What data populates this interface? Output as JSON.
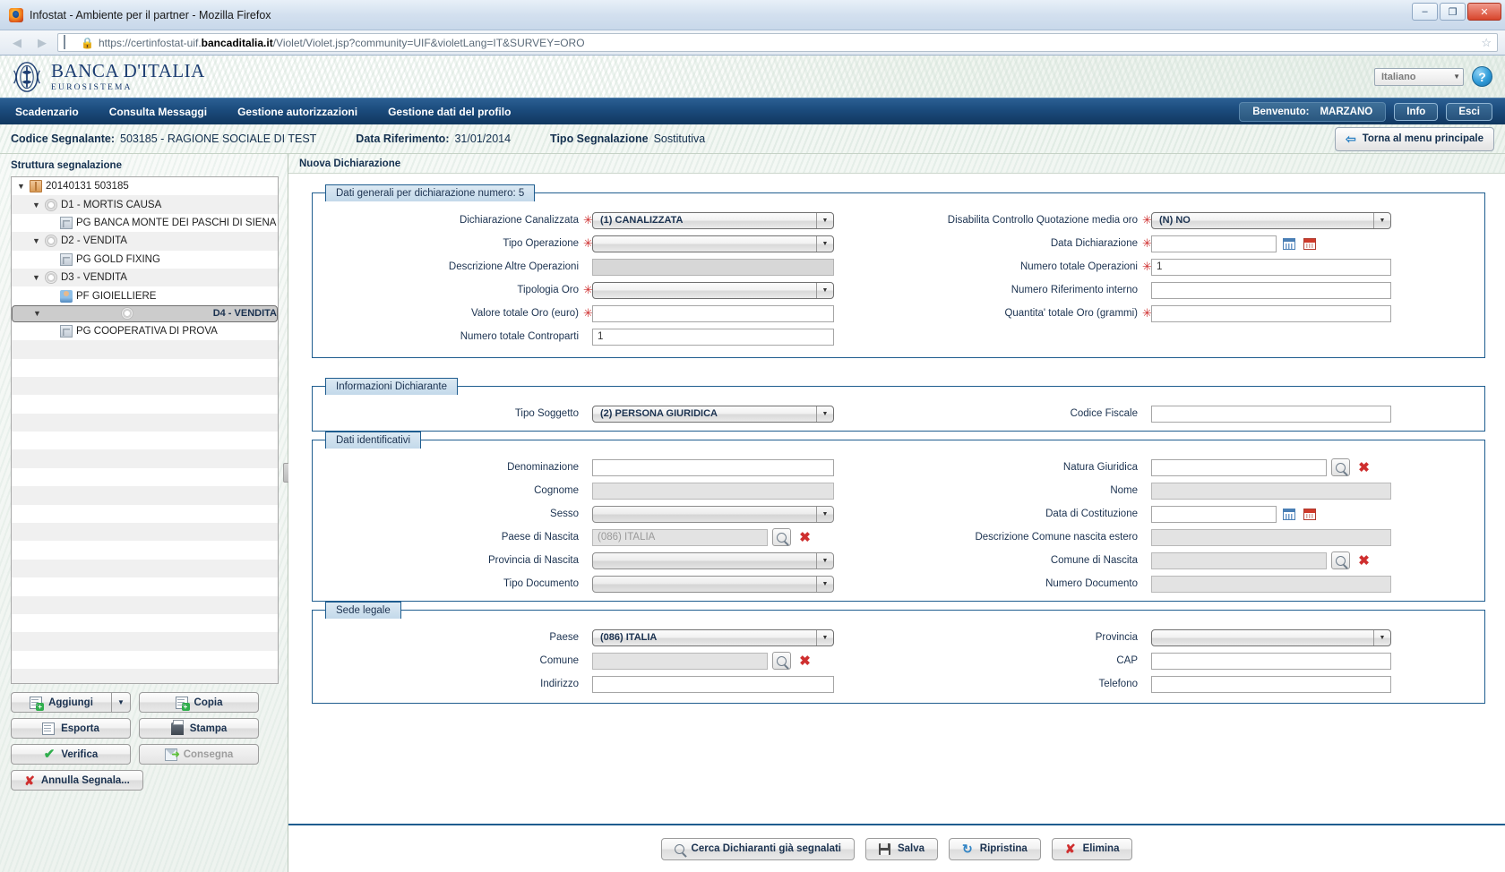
{
  "browser": {
    "window_title": "Infostat - Ambiente per il partner - Mozilla Firefox",
    "favicon": "firefox-icon",
    "url_prefix": "https://certinfostat-uif.",
    "url_domain": "bancaditalia.it",
    "url_suffix": "/Violet/Violet.jsp?community=UIF&violetLang=IT&SURVEY=ORO",
    "minimize_label": "–",
    "maximize_label": "❐",
    "close_label": "✕",
    "back_arrow": "◀",
    "forward_arrow": "▶",
    "star": "☆"
  },
  "bank_header": {
    "logo_line1": "BANCA D'ITALIA",
    "logo_line2": "EUROSISTEMA",
    "language_value": "Italiano",
    "language_caret": "▼",
    "help_label": "?"
  },
  "navbar": {
    "items": [
      {
        "label": "Scadenzario"
      },
      {
        "label": "Consulta Messaggi"
      },
      {
        "label": "Gestione autorizzazioni"
      },
      {
        "label": "Gestione dati del profilo"
      }
    ],
    "welcome_label": "Benvenuto:",
    "welcome_user": "MARZANO",
    "info_label": "Info",
    "exit_label": "Esci"
  },
  "subheader": {
    "codice_label": "Codice Segnalante:",
    "codice_value": "503185 - RAGIONE SOCIALE DI TEST",
    "data_label": "Data Riferimento:",
    "data_value": "31/01/2014",
    "tipo_label": "Tipo Segnalazione",
    "tipo_value": "Sostitutiva",
    "back_label": "Torna al menu principale",
    "back_arrow": "⇦"
  },
  "sidebar": {
    "title": "Struttura segnalazione",
    "tree": [
      {
        "label": "20140131 503185",
        "icon": "box-icon",
        "indent": 0,
        "expandable": true,
        "row": "plain",
        "selected": false
      },
      {
        "label": "D1 - MORTIS CAUSA",
        "icon": "gear-icon",
        "indent": 1,
        "expandable": true,
        "row": "alt",
        "selected": false
      },
      {
        "label": "PG BANCA MONTE DEI PASCHI DI SIENA",
        "icon": "building-icon",
        "indent": 2,
        "expandable": false,
        "row": "plain",
        "selected": false
      },
      {
        "label": "D2 - VENDITA",
        "icon": "gear-icon",
        "indent": 1,
        "expandable": true,
        "row": "alt",
        "selected": false
      },
      {
        "label": "PG GOLD FIXING",
        "icon": "building-icon",
        "indent": 2,
        "expandable": false,
        "row": "plain",
        "selected": false
      },
      {
        "label": "D3 - VENDITA",
        "icon": "gear-icon",
        "indent": 1,
        "expandable": true,
        "row": "alt",
        "selected": false
      },
      {
        "label": "PF GIOIELLIERE",
        "icon": "person-icon",
        "indent": 2,
        "expandable": false,
        "row": "plain",
        "selected": false
      },
      {
        "label": "D4 - VENDITA",
        "icon": "gear-icon",
        "indent": 1,
        "expandable": true,
        "row": "alt",
        "selected": true
      },
      {
        "label": "PG COOPERATIVA DI PROVA",
        "icon": "building-icon",
        "indent": 2,
        "expandable": false,
        "row": "plain",
        "selected": false
      }
    ],
    "expand_triangle": "▼",
    "buttons": {
      "aggiungi": "Aggiungi",
      "aggiungi_caret": "▼",
      "copia": "Copia",
      "esporta": "Esporta",
      "stampa": "Stampa",
      "verifica": "Verifica",
      "consegna": "Consegna",
      "annulla": "Annulla Segnala..."
    }
  },
  "main": {
    "title": "Nuova Dichiarazione",
    "panels": {
      "dati_generali": {
        "legend": "Dati generali per dichiarazione numero: 5",
        "left_fields": [
          {
            "label": "Dichiarazione Canalizzata",
            "required": true,
            "type": "select",
            "value": "(1) CANALIZZATA",
            "disabled": false
          },
          {
            "label": "Tipo Operazione",
            "required": true,
            "type": "select",
            "value": "",
            "disabled": false
          },
          {
            "label": "Descrizione Altre Operazioni",
            "required": false,
            "type": "input",
            "value": "",
            "disabled": true
          },
          {
            "label": "Tipologia Oro",
            "required": true,
            "type": "select",
            "value": "",
            "disabled": false
          },
          {
            "label": "Valore totale Oro (euro)",
            "required": true,
            "type": "input",
            "value": "",
            "disabled": false
          },
          {
            "label": "Numero totale Controparti",
            "required": false,
            "type": "input",
            "value": "1",
            "disabled": false
          }
        ],
        "right_fields": [
          {
            "label": "Disabilita Controllo Quotazione media oro",
            "required": true,
            "type": "select",
            "value": "(N) NO"
          },
          {
            "label": "Data Dichiarazione",
            "required": true,
            "type": "date",
            "value": ""
          },
          {
            "label": "Numero totale Operazioni",
            "required": true,
            "type": "input",
            "value": "1"
          },
          {
            "label": "Numero Riferimento interno",
            "required": false,
            "type": "input",
            "value": ""
          },
          {
            "label": "Quantita' totale Oro (grammi)",
            "required": true,
            "type": "input",
            "value": ""
          }
        ]
      },
      "informazioni_dichiarante": {
        "legend": "Informazioni Dichiarante",
        "tipo_soggetto_label": "Tipo Soggetto",
        "tipo_soggetto_value": "(2) PERSONA GIURIDICA",
        "codice_fiscale_label": "Codice Fiscale",
        "codice_fiscale_value": ""
      },
      "dati_identificativi": {
        "legend": "Dati identificativi",
        "left_fields": [
          {
            "label": "Denominazione",
            "type": "input",
            "value": "",
            "state": "normal"
          },
          {
            "label": "Cognome",
            "type": "input",
            "value": "",
            "state": "readonly"
          },
          {
            "label": "Sesso",
            "type": "select",
            "value": "",
            "state": "disabled"
          },
          {
            "label": "Paese di Nascita",
            "type": "lookup",
            "value": "(086) ITALIA",
            "state": "readonly"
          },
          {
            "label": "Provincia di Nascita",
            "type": "select",
            "value": "",
            "state": "disabled"
          },
          {
            "label": "Tipo Documento",
            "type": "select",
            "value": "",
            "state": "disabled"
          }
        ],
        "right_fields": [
          {
            "label": "Natura Giuridica",
            "type": "lookup",
            "value": "",
            "state": "normal"
          },
          {
            "label": "Nome",
            "type": "input",
            "value": "",
            "state": "readonly"
          },
          {
            "label": "Data di Costituzione",
            "type": "date",
            "value": "",
            "state": "normal"
          },
          {
            "label": "Descrizione Comune nascita estero",
            "type": "input",
            "value": "",
            "state": "readonly"
          },
          {
            "label": "Comune di Nascita",
            "type": "lookup",
            "value": "",
            "state": "readonly"
          },
          {
            "label": "Numero Documento",
            "type": "input",
            "value": "",
            "state": "readonly"
          }
        ]
      },
      "sede_legale": {
        "legend": "Sede legale",
        "left_fields": [
          {
            "label": "Paese",
            "type": "select",
            "value": "(086) ITALIA",
            "state": "normal"
          },
          {
            "label": "Comune",
            "type": "lookup",
            "value": "",
            "state": "readonly"
          },
          {
            "label": "Indirizzo",
            "type": "input",
            "value": "",
            "state": "normal"
          }
        ],
        "right_fields": [
          {
            "label": "Provincia",
            "type": "select",
            "value": "",
            "state": "normal"
          },
          {
            "label": "CAP",
            "type": "input",
            "value": "",
            "state": "normal"
          },
          {
            "label": "Telefono",
            "type": "input",
            "value": "",
            "state": "normal"
          }
        ]
      }
    },
    "footer_buttons": {
      "cerca": "Cerca Dichiaranti già segnalati",
      "salva": "Salva",
      "ripristina": "Ripristina",
      "elimina": "Elimina"
    }
  }
}
